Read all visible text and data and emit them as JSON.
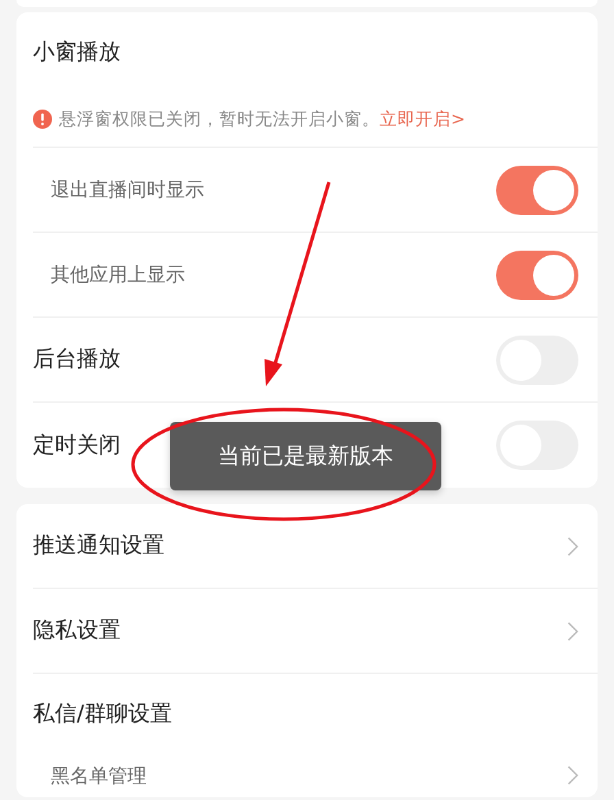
{
  "cards": [
    {
      "items": [
        {
          "kind": "header",
          "label": "小窗播放",
          "notice": {
            "text": "悬浮窗权限已关闭，暂时无法开启小窗。",
            "link": "立即开启>"
          },
          "children": [
            {
              "kind": "toggle",
              "label": "退出直播间时显示",
              "on": true
            },
            {
              "kind": "toggle",
              "label": "其他应用上显示",
              "on": true
            }
          ]
        },
        {
          "kind": "toggle",
          "label": "后台播放",
          "on": false
        },
        {
          "kind": "toggle",
          "label": "定时关闭",
          "on": false
        }
      ]
    },
    {
      "items": [
        {
          "kind": "link",
          "label": "推送通知设置"
        },
        {
          "kind": "link",
          "label": "隐私设置"
        },
        {
          "kind": "header",
          "label": "私信/群聊设置",
          "children": [
            {
              "kind": "link",
              "label": "黑名单管理"
            }
          ]
        }
      ]
    }
  ],
  "toast": "当前已是最新版本"
}
